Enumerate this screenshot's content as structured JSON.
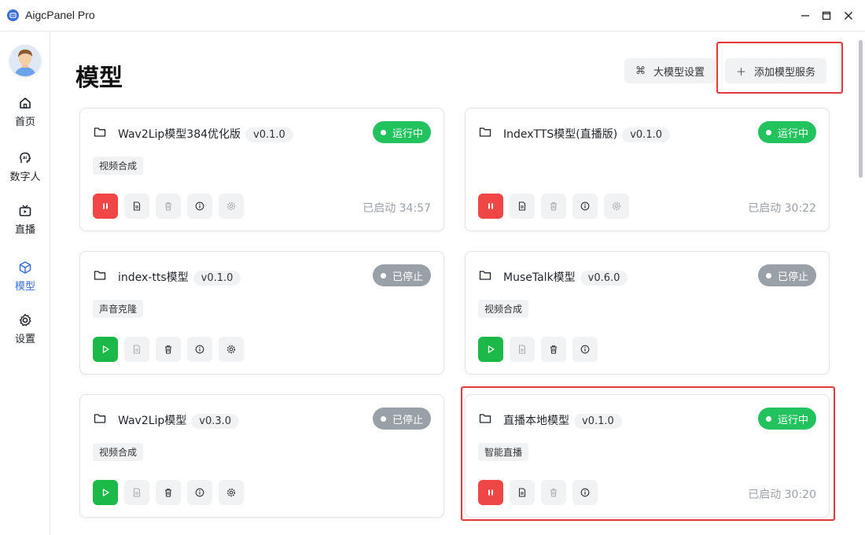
{
  "app": {
    "title": "AigcPanel Pro"
  },
  "sidebar": {
    "items": [
      {
        "label": "首页",
        "icon": "home-icon",
        "active": false
      },
      {
        "label": "数字人",
        "icon": "ai-head-icon",
        "active": false
      },
      {
        "label": "直播",
        "icon": "tv-icon",
        "active": false
      },
      {
        "label": "模型",
        "icon": "cube-icon",
        "active": true
      },
      {
        "label": "设置",
        "icon": "gear-icon",
        "active": false
      }
    ]
  },
  "header": {
    "title": "模型",
    "settings_button": {
      "icon": "⌘",
      "label": "大模型设置"
    },
    "add_button": {
      "icon": "＋",
      "label": "添加模型服务"
    }
  },
  "cards": [
    {
      "name": "Wav2Lip模型384优化版",
      "version": "v0.1.0",
      "status": "运行中",
      "running": true,
      "tag": "视频合成",
      "uptime": "已启动 34:57",
      "has_settings": true
    },
    {
      "name": "IndexTTS模型(直播版)",
      "version": "v0.1.0",
      "status": "运行中",
      "running": true,
      "tag": "",
      "uptime": "已启动 30:22",
      "has_settings": true
    },
    {
      "name": "index-tts模型",
      "version": "v0.1.0",
      "status": "已停止",
      "running": false,
      "tag": "声音克隆",
      "uptime": "",
      "has_settings": true
    },
    {
      "name": "MuseTalk模型",
      "version": "v0.6.0",
      "status": "已停止",
      "running": false,
      "tag": "视频合成",
      "uptime": "",
      "has_settings": false
    },
    {
      "name": "Wav2Lip模型",
      "version": "v0.3.0",
      "status": "已停止",
      "running": false,
      "tag": "视频合成",
      "uptime": "",
      "has_settings": true
    },
    {
      "name": "直播本地模型",
      "version": "v0.1.0",
      "status": "运行中",
      "running": true,
      "tag": "智能直播",
      "uptime": "已启动 30:20",
      "has_settings": false
    }
  ],
  "colors": {
    "accent": "#3b6fd8",
    "running": "#22c35e",
    "stopped": "#9aa0a8",
    "pause": "#f04646",
    "play": "#1cb848",
    "highlight": "#e5383b"
  }
}
